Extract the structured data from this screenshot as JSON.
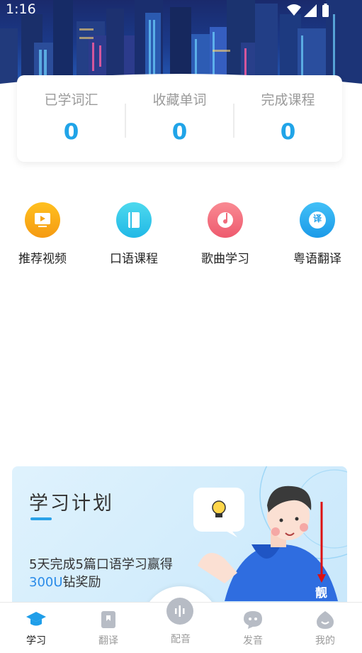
{
  "status_bar": {
    "time": "1:16"
  },
  "stats": [
    {
      "label": "已学词汇",
      "value": "0"
    },
    {
      "label": "收藏单词",
      "value": "0"
    },
    {
      "label": "完成课程",
      "value": "0"
    }
  ],
  "features": [
    {
      "label": "推荐视频",
      "icon": "video-icon",
      "color": "#f7a61a"
    },
    {
      "label": "口语课程",
      "icon": "book-icon",
      "color": "#2ec8e8"
    },
    {
      "label": "歌曲学习",
      "icon": "music-disc-icon",
      "color": "#f26c7b"
    },
    {
      "label": "粤语翻译",
      "icon": "translate-icon",
      "color": "#2aa8f0",
      "icon_text": "译"
    }
  ],
  "plan": {
    "title": "学习计划",
    "desc_prefix": "5天完成5篇口语学习赢得",
    "desc_highlight": "300U",
    "desc_suffix": "钻奖励",
    "badge_char": "靓"
  },
  "tabs": [
    {
      "label": "学习",
      "icon": "graduation-cap-icon",
      "active": true
    },
    {
      "label": "翻译",
      "icon": "bookmark-icon",
      "active": false
    },
    {
      "label": "配音",
      "icon": "voice-wave-icon",
      "active": false
    },
    {
      "label": "发音",
      "icon": "chat-bubble-icon",
      "active": false
    },
    {
      "label": "我的",
      "icon": "profile-icon",
      "active": false
    }
  ],
  "colors": {
    "accent": "#20a4e8",
    "highlight": "#2a8be8"
  }
}
